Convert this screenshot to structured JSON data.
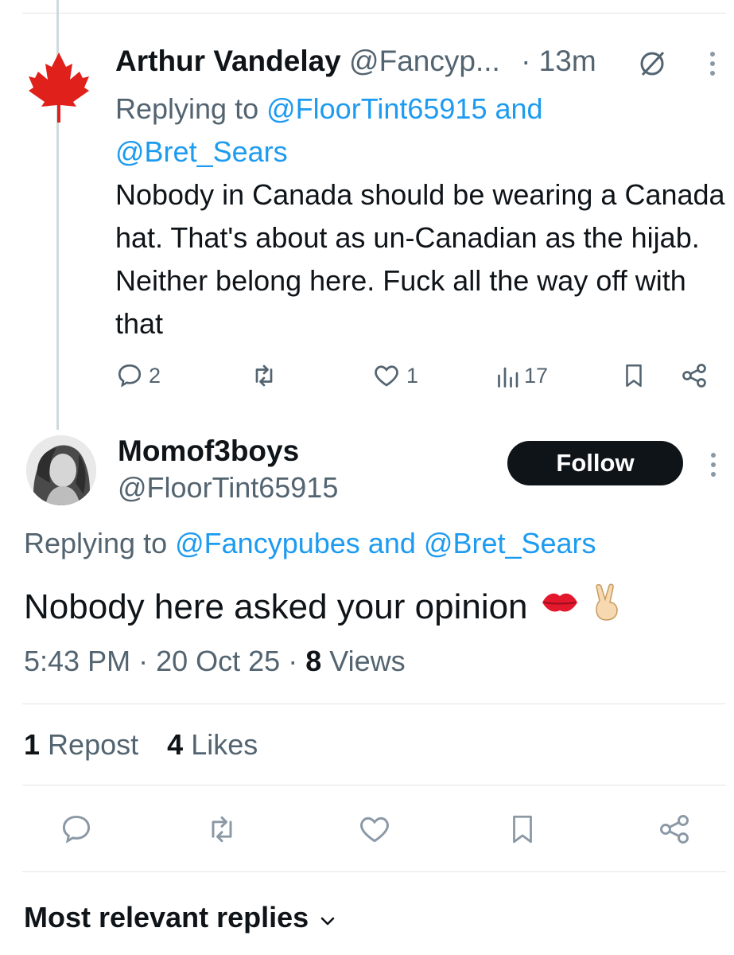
{
  "thread_tweet": {
    "name": "Arthur Vandelay",
    "handle": "@Fancyp...",
    "time": "· 13m",
    "replying_prefix": "Replying to",
    "replying_user1": "@FloorTint65915",
    "replying_and": "and",
    "replying_user2": "@Bret_Sears",
    "text": "Nobody in Canada should be wearing a Canada hat.  That's about as un-Canadian as the hijab.  Neither belong here. Fuck all the way off with that",
    "stats": {
      "replies": "2",
      "likes": "1",
      "views": "17"
    },
    "avatar_icon": "maple-leaf-icon"
  },
  "main_tweet": {
    "name": "Momof3boys",
    "handle": "@FloorTint65915",
    "follow_label": "Follow",
    "replying_prefix": "Replying to",
    "replying_user1": "@Fancypubes",
    "replying_and": "and",
    "replying_user2": "@Bret_Sears",
    "text": "Nobody here asked your opinion",
    "emojis": [
      "kiss-mark-icon",
      "victory-hand-icon"
    ],
    "time": "5:43 PM",
    "date": "20 Oct 25",
    "views_count": "8",
    "views_label": "Views",
    "reposts_count": "1",
    "reposts_label": "Repost",
    "likes_count": "4",
    "likes_label": "Likes"
  },
  "sort": {
    "label": "Most relevant replies"
  },
  "colors": {
    "link": "#1d9bf0",
    "muted": "#536471",
    "text": "#0f1419",
    "flag_red": "#e0201b"
  }
}
